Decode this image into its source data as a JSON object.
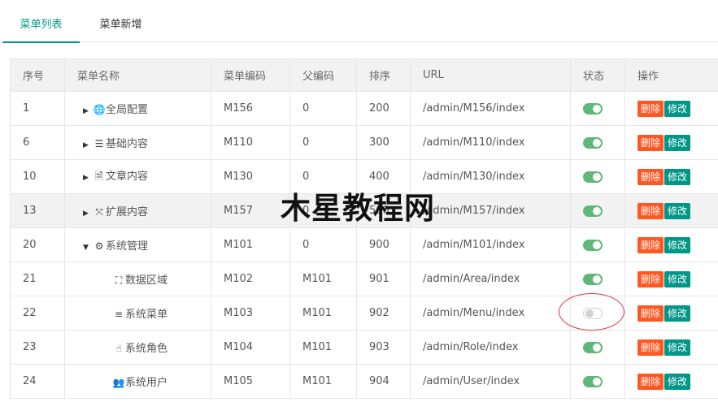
{
  "tabs": [
    {
      "label": "菜单列表",
      "active": true
    },
    {
      "label": "菜单新增",
      "active": false
    }
  ],
  "table": {
    "headers": [
      "序号",
      "菜单名称",
      "菜单编码",
      "父编码",
      "排序",
      "URL",
      "状态",
      "操作"
    ],
    "rows": [
      {
        "id": "1",
        "name": "全局配置",
        "icon": "globe-icon",
        "caret": "right",
        "level": 1,
        "code": "M156",
        "parent": "0",
        "sort": "200",
        "url": "/admin/M156/index",
        "status": true
      },
      {
        "id": "6",
        "name": "基础内容",
        "icon": "sliders-icon",
        "caret": "right",
        "level": 1,
        "code": "M110",
        "parent": "0",
        "sort": "300",
        "url": "/admin/M110/index",
        "status": true
      },
      {
        "id": "10",
        "name": "文章内容",
        "icon": "document-icon",
        "caret": "right",
        "level": 1,
        "code": "M130",
        "parent": "0",
        "sort": "400",
        "url": "/admin/M130/index",
        "status": true
      },
      {
        "id": "13",
        "name": "扩展内容",
        "icon": "expand-icon",
        "caret": "right",
        "level": 1,
        "code": "M157",
        "parent": "0",
        "sort": "500",
        "url": "/admin/M157/index",
        "status": true
      },
      {
        "id": "20",
        "name": "系统管理",
        "icon": "gear-icon",
        "caret": "down",
        "level": 1,
        "code": "M101",
        "parent": "0",
        "sort": "900",
        "url": "/admin/M101/index",
        "status": true
      },
      {
        "id": "21",
        "name": "数据区域",
        "icon": "sitemap-icon",
        "caret": "",
        "level": 2,
        "code": "M102",
        "parent": "M101",
        "sort": "901",
        "url": "/admin/Area/index",
        "status": true
      },
      {
        "id": "22",
        "name": "系统菜单",
        "icon": "list-icon",
        "caret": "",
        "level": 2,
        "code": "M103",
        "parent": "M101",
        "sort": "902",
        "url": "/admin/Menu/index",
        "status": false
      },
      {
        "id": "23",
        "name": "系统角色",
        "icon": "hand-icon",
        "caret": "",
        "level": 2,
        "code": "M104",
        "parent": "M101",
        "sort": "903",
        "url": "/admin/Role/index",
        "status": true
      },
      {
        "id": "24",
        "name": "系统用户",
        "icon": "users-icon",
        "caret": "",
        "level": 2,
        "code": "M105",
        "parent": "M101",
        "sort": "904",
        "url": "/admin/User/index",
        "status": true
      }
    ],
    "actions": {
      "delete": "删除",
      "edit": "修改"
    }
  },
  "watermark": "木星教程网",
  "colors": {
    "accent": "#009688",
    "switch_on": "#5FB878",
    "delete": "#FF5722",
    "annotation": "#dd3333"
  }
}
